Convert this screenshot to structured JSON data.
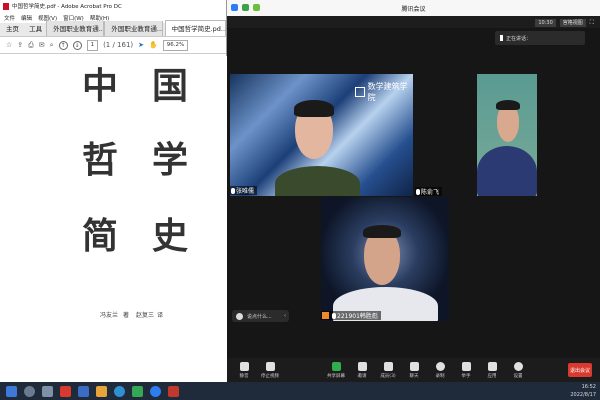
{
  "acrobat": {
    "window_title": "中国哲学简史.pdf - Adobe Acrobat Pro DC",
    "menu": [
      "文件",
      "编辑",
      "视图(V)",
      "窗口(W)",
      "帮助(H)"
    ],
    "tabs": [
      "主页",
      "工具",
      "外国职业教育通...",
      "外国职业教育通...",
      "中国哲学简史.pd..."
    ],
    "page_field": "(1 / 161)",
    "zoom": "96.2%",
    "page_chars": [
      "中",
      "国",
      "哲",
      "学",
      "简",
      "史"
    ],
    "authors": [
      "冯友兰",
      "著",
      "赵复三",
      "译"
    ]
  },
  "meeting": {
    "window_title": "腾讯会议",
    "clock": "10:30",
    "view_button": "宫格视图",
    "speaking_label": "正在讲话：",
    "video_logo": "数学建筑学院",
    "participants": [
      {
        "name": "张唯儒"
      },
      {
        "name": "陈俞飞"
      },
      {
        "name": "221901韩胜彪"
      }
    ],
    "chat_placeholder": "说点什么...",
    "toolbar": [
      "静音",
      "停止视频",
      "共享屏幕",
      "邀请",
      "成员(3)",
      "聊天",
      "录制",
      "举手",
      "应用",
      "设置"
    ],
    "end_button": "退出会议"
  },
  "taskbar": {
    "time": "16:52",
    "date": "2022/8/17"
  }
}
